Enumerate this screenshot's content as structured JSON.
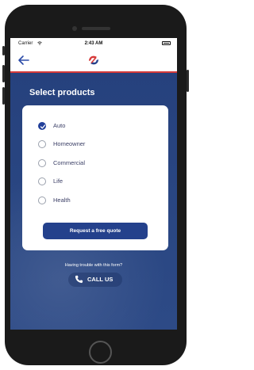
{
  "status_bar": {
    "carrier": "Carrier",
    "time": "2:43 AM"
  },
  "nav": {
    "back_icon": "arrow-left-icon",
    "logo_icon": "brand-logo"
  },
  "page": {
    "title": "Select products"
  },
  "products": [
    {
      "label": "Auto",
      "checked": true
    },
    {
      "label": "Homeowner",
      "checked": false
    },
    {
      "label": "Commercial",
      "checked": false
    },
    {
      "label": "Life",
      "checked": false
    },
    {
      "label": "Health",
      "checked": false
    }
  ],
  "quote_button": {
    "label": "Request a free quote"
  },
  "help": {
    "text": "Having trouble with this form?",
    "call_label": "CALL US",
    "call_icon": "phone-icon"
  },
  "colors": {
    "primary": "#24418c",
    "accent": "#d63a3a",
    "background": "#25407b"
  }
}
